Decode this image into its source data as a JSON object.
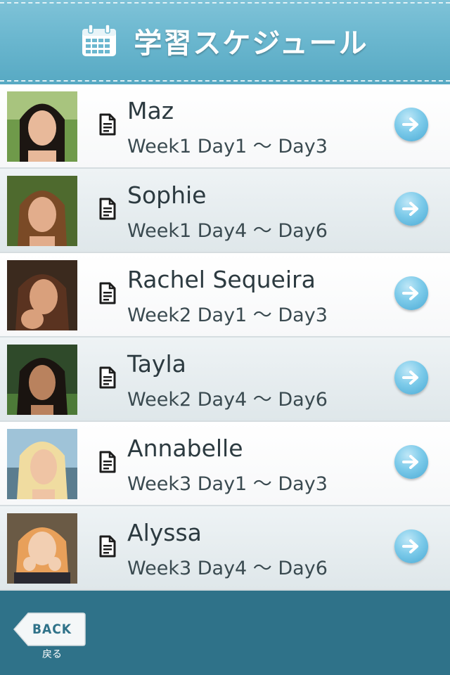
{
  "header": {
    "title": "学習スケジュール",
    "icon": "calendar-icon"
  },
  "schedule": [
    {
      "name": "Maz",
      "range": "Week1  Day1 〜 Day3",
      "avatar": "portrait-photo",
      "style": "light"
    },
    {
      "name": "Sophie",
      "range": "Week1  Day4 〜 Day6",
      "avatar": "portrait-photo",
      "style": "shaded"
    },
    {
      "name": "Rachel Sequeira",
      "range": "Week2  Day1 〜 Day3",
      "avatar": "portrait-photo",
      "style": "light"
    },
    {
      "name": "Tayla",
      "range": "Week2  Day4 〜 Day6",
      "avatar": "portrait-photo",
      "style": "shaded"
    },
    {
      "name": "Annabelle",
      "range": "Week3  Day1 〜 Day3",
      "avatar": "portrait-photo",
      "style": "light"
    },
    {
      "name": "Alyssa",
      "range": "Week3  Day4 〜 Day6",
      "avatar": "portrait-photo",
      "style": "shaded"
    }
  ],
  "footer": {
    "back_label": "BACK",
    "back_sublabel": "戻る"
  },
  "colors": {
    "header": "#6bb7cf",
    "footer": "#2f7289",
    "accent": "#4aa9d4",
    "text": "#2c3a40"
  }
}
